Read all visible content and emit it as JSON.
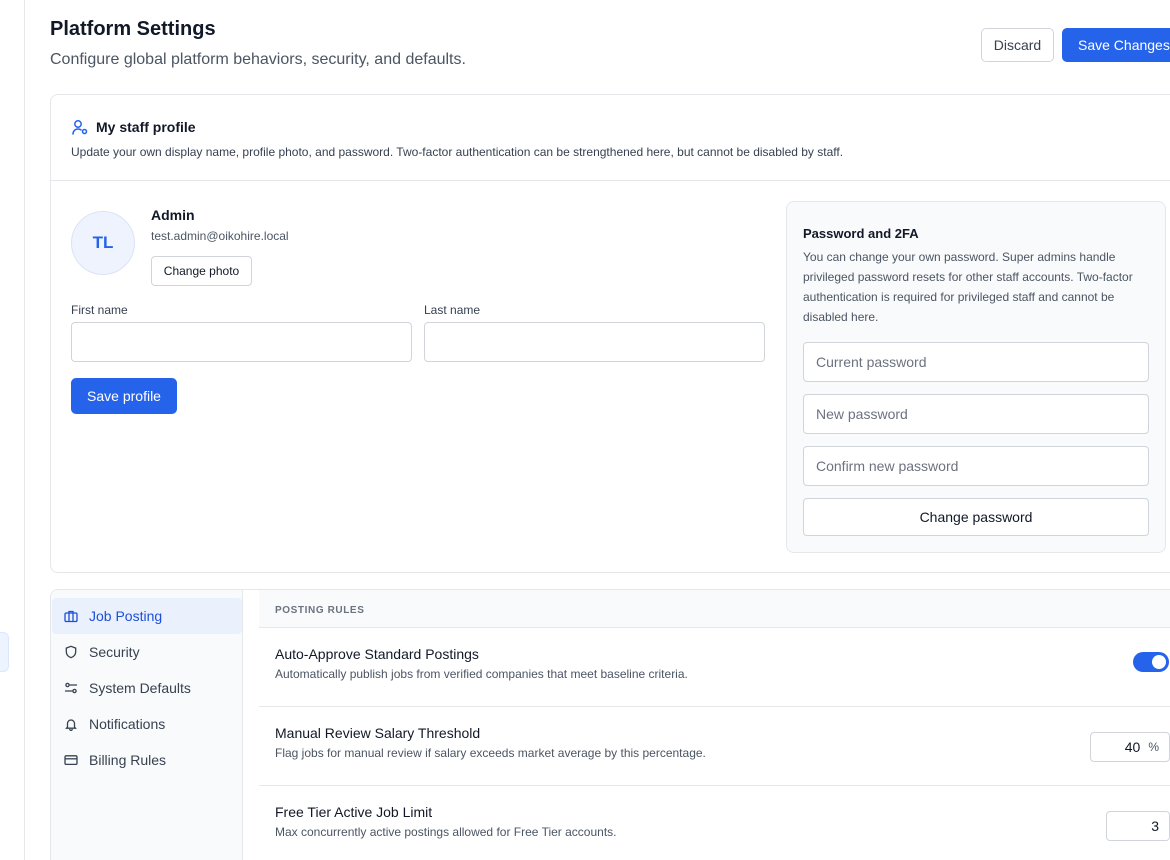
{
  "header": {
    "title": "Platform Settings",
    "subtitle": "Configure global platform behaviors, security, and defaults.",
    "discard_label": "Discard",
    "save_label": "Save Changes"
  },
  "profile_card": {
    "title": "My staff profile",
    "description": "Update your own display name, profile photo, and password. Two-factor authentication can be strengthened here, but cannot be disabled by staff.",
    "avatar_initials": "TL",
    "name": "Admin",
    "email": "test.admin@oikohire.local",
    "change_photo_label": "Change photo",
    "first_name_label": "First name",
    "first_name_value": "",
    "last_name_label": "Last name",
    "last_name_value": "",
    "save_profile_label": "Save profile"
  },
  "password_panel": {
    "title": "Password and 2FA",
    "description": "You can change your own password. Super admins handle privileged password resets for other staff accounts. Two-factor authentication is required for privileged staff and cannot be disabled here.",
    "current_placeholder": "Current password",
    "new_placeholder": "New password",
    "confirm_placeholder": "Confirm new password",
    "change_label": "Change password"
  },
  "settings_nav": [
    {
      "label": "Job Posting",
      "icon": "briefcase-icon",
      "active": true
    },
    {
      "label": "Security",
      "icon": "shield-icon",
      "active": false
    },
    {
      "label": "System Defaults",
      "icon": "sliders-icon",
      "active": false
    },
    {
      "label": "Notifications",
      "icon": "bell-icon",
      "active": false
    },
    {
      "label": "Billing Rules",
      "icon": "credit-card-icon",
      "active": false
    }
  ],
  "posting_rules": {
    "section_label": "POSTING RULES",
    "rows": [
      {
        "title": "Auto-Approve Standard Postings",
        "description": "Automatically publish jobs from verified companies that meet baseline criteria.",
        "toggle_on": true
      },
      {
        "title": "Manual Review Salary Threshold",
        "description": "Flag jobs for manual review if salary exceeds market average by this percentage.",
        "value": "40",
        "unit": "%"
      },
      {
        "title": "Free Tier Active Job Limit",
        "description": "Max concurrently active postings allowed for Free Tier accounts.",
        "value": "3"
      }
    ]
  },
  "colors": {
    "accent": "#2563eb",
    "border": "#e5e7eb",
    "panel_bg": "#f9fafb"
  }
}
